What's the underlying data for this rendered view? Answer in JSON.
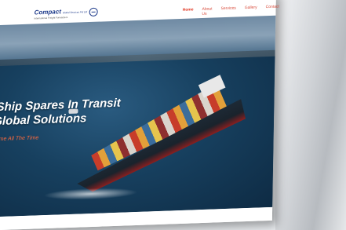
{
  "brand": {
    "name": "Compact",
    "name_small": "Global Services Pvt Ltd",
    "tagline": "International Freight Forwarders"
  },
  "nav": {
    "items": [
      "Home",
      "About Us",
      "Services",
      "Gallery",
      "Contact"
    ]
  },
  "hero": {
    "line1": "Ship Spares In Transit",
    "line2": "Global Solutions",
    "tagline": "Time All The Time"
  },
  "colors": {
    "accent": "#e0311c",
    "brand": "#1d3a8a"
  }
}
